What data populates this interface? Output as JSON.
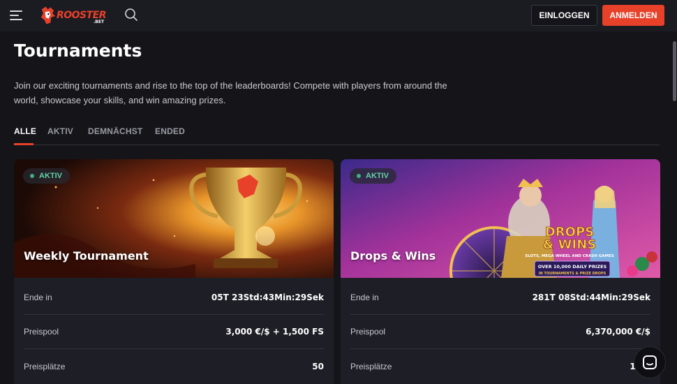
{
  "header": {
    "logo_text": "ROOSTER",
    "logo_sub": ".BET",
    "login_label": "EINLOGGEN",
    "register_label": "ANMELDEN"
  },
  "page": {
    "title": "Tournaments",
    "intro": "Join our exciting tournaments and rise to the top of the leaderboards! Compete with players from around the world, showcase your skills, and win amazing prizes."
  },
  "tabs": [
    {
      "label": "ALLE",
      "active": true
    },
    {
      "label": "AKTIV",
      "active": false
    },
    {
      "label": "DEMNÄCHST",
      "active": false
    },
    {
      "label": "ENDED",
      "active": false
    }
  ],
  "tournaments": [
    {
      "status": "AKTIV",
      "title": "Weekly Tournament",
      "rows": [
        {
          "label": "Ende in",
          "value": "05T 23Std:43Min:29Sek"
        },
        {
          "label": "Preispool",
          "value": "3,000 €/$ + 1,500 FS"
        },
        {
          "label": "Preisplätze",
          "value": "50"
        }
      ]
    },
    {
      "status": "AKTIV",
      "title": "Drops & Wins",
      "banner_text": {
        "line1": "DROPS",
        "line2": "& WINS",
        "tagline": "SLOTS, MEGA WHEEL AND CRASH GAMES",
        "promo": "OVER 10,000 DAILY PRIZES",
        "promo_sub": "IN TOURNAMENTS & PRIZE DROPS"
      },
      "rows": [
        {
          "label": "Ende in",
          "value": "281T 08Std:44Min:29Sek"
        },
        {
          "label": "Preispool",
          "value": "6,370,000 €/$"
        },
        {
          "label": "Preisplätze",
          "value": "10,0"
        }
      ]
    }
  ],
  "colors": {
    "accent": "#e8412a",
    "background": "#141419",
    "card": "#1e1e26",
    "status_green": "#5fd3a8"
  },
  "icons": [
    "menu-icon",
    "rooster-logo-icon",
    "search-icon",
    "chat-icon"
  ]
}
